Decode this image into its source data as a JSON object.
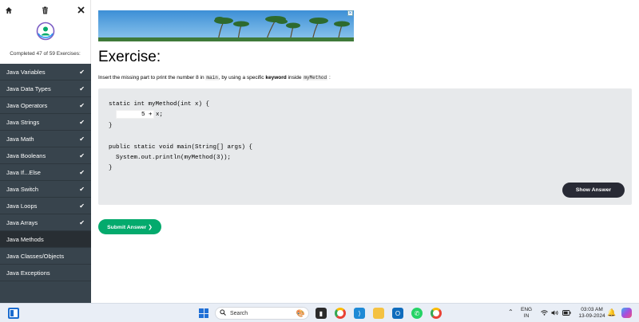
{
  "sidebar": {
    "home_icon": "home-icon",
    "trash_icon": "trash-icon",
    "close_icon": "close-icon",
    "progress_text": "Completed 47 of 59 Exercises:",
    "items": [
      {
        "label": "Java Variables",
        "done": true
      },
      {
        "label": "Java Data Types",
        "done": true
      },
      {
        "label": "Java Operators",
        "done": true
      },
      {
        "label": "Java Strings",
        "done": true
      },
      {
        "label": "Java Math",
        "done": true
      },
      {
        "label": "Java Booleans",
        "done": true
      },
      {
        "label": "Java If...Else",
        "done": true
      },
      {
        "label": "Java Switch",
        "done": true
      },
      {
        "label": "Java Loops",
        "done": true
      },
      {
        "label": "Java Arrays",
        "done": true
      },
      {
        "label": "Java Methods",
        "done": false,
        "active": true
      },
      {
        "label": "Java Classes/Objects",
        "done": false
      },
      {
        "label": "Java Exceptions",
        "done": false
      }
    ]
  },
  "main": {
    "title": "Exercise:",
    "instruction": {
      "part1": "Insert the missing part to print the number 8 in ",
      "code1": "main",
      "part2": ", by using a specific ",
      "bold": "keyword",
      "part3": " inside ",
      "code2": "myMethod",
      "part4": " :"
    },
    "code_lines": {
      "l1": "static int myMethod(int x) {",
      "l2": "5 + x;",
      "l3": "}",
      "l4": "public static void main(String[] args) {",
      "l5": "  System.out.println(myMethod(3));",
      "l6": "}"
    },
    "show_answer": "Show Answer",
    "submit_answer": "Submit Answer ❯",
    "ad_close": "✕"
  },
  "taskbar": {
    "search_placeholder": "Search",
    "lang_line1": "ENG",
    "lang_line2": "IN",
    "time": "03:03 AM",
    "date": "13-09-2024"
  },
  "colors": {
    "sidebar_bg": "#38444d",
    "accent_green": "#04aa6d",
    "dark_button": "#282a35",
    "code_bg": "#e7e9eb"
  }
}
